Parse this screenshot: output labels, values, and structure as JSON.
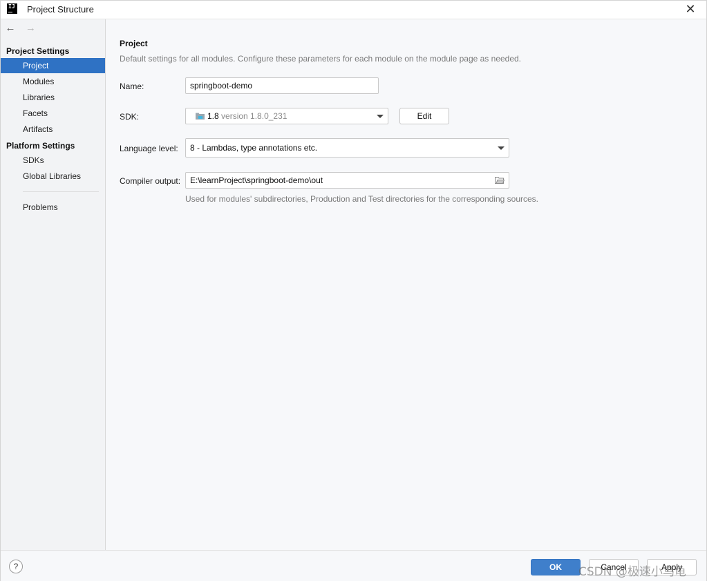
{
  "window": {
    "title": "Project Structure",
    "logo_text": "IJ",
    "close_glyph": "✕"
  },
  "sidebar": {
    "back_glyph": "←",
    "forward_glyph": "→",
    "project_settings_header": "Project Settings",
    "project_settings_items": [
      {
        "label": "Project",
        "selected": true
      },
      {
        "label": "Modules",
        "selected": false
      },
      {
        "label": "Libraries",
        "selected": false
      },
      {
        "label": "Facets",
        "selected": false
      },
      {
        "label": "Artifacts",
        "selected": false
      }
    ],
    "platform_settings_header": "Platform Settings",
    "platform_settings_items": [
      {
        "label": "SDKs"
      },
      {
        "label": "Global Libraries"
      }
    ],
    "problems_label": "Problems"
  },
  "main": {
    "section_title": "Project",
    "section_desc": "Default settings for all modules. Configure these parameters for each module on the module page as needed.",
    "name_label": "Name:",
    "name_value": "springboot-demo",
    "sdk_label": "SDK:",
    "sdk_name": "1.8",
    "sdk_version": "version 1.8.0_231",
    "edit_button": "Edit",
    "language_level_label": "Language level:",
    "language_level_value": "8 - Lambdas, type annotations etc.",
    "compiler_output_label": "Compiler output:",
    "compiler_output_value": "E:\\learnProject\\springboot-demo\\out",
    "compiler_output_hint": "Used for modules' subdirectories, Production and Test directories for the corresponding sources."
  },
  "footer": {
    "help_glyph": "?",
    "ok_label": "OK",
    "cancel_label": "Cancel",
    "apply_label": "Apply",
    "watermark": "CSDN @极速小乌龟"
  },
  "colors": {
    "selection": "#2f72c4",
    "ok_button": "#3f7fcb"
  }
}
